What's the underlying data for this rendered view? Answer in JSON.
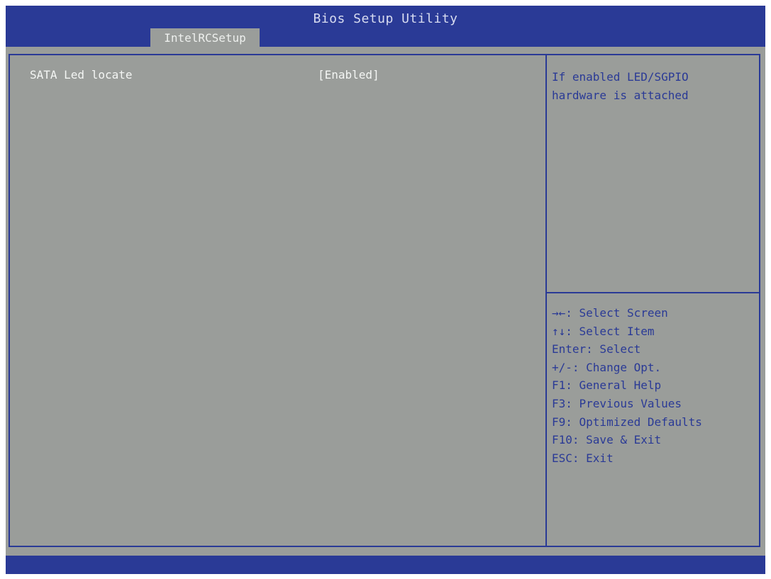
{
  "window": {
    "title": "Bios Setup Utility"
  },
  "tabs": [
    {
      "label": "IntelRCSetup",
      "active": true
    }
  ],
  "settings": [
    {
      "label": "SATA Led locate",
      "value": "[Enabled]"
    }
  ],
  "help": {
    "lines": [
      "If enabled LED/SGPIO",
      "hardware is attached"
    ],
    "keys": [
      "→←: Select Screen",
      "↑↓: Select Item",
      "Enter: Select",
      "+/-: Change Opt.",
      "F1: General Help",
      "F3: Previous Values",
      "F9: Optimized Defaults",
      "F10: Save & Exit",
      "ESC: Exit"
    ]
  },
  "colors": {
    "bar": "#2a3a96",
    "background": "#9a9d9a",
    "setting_text": "#f4f6f4",
    "help_text": "#2a3a96"
  }
}
